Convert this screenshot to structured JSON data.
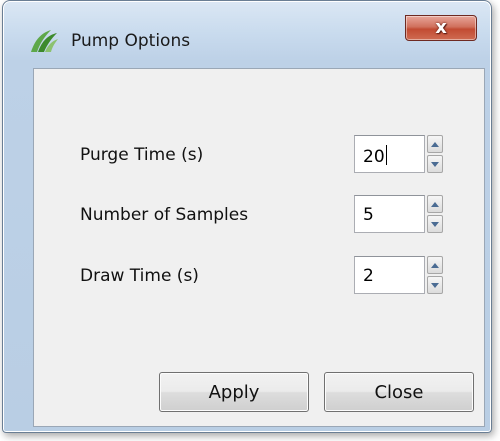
{
  "window": {
    "title": "Pump Options",
    "close_symbol": "x"
  },
  "icons": {
    "app": "leaf-logo-icon",
    "close": "close-icon",
    "spin_up": "arrow-up-icon",
    "spin_down": "arrow-down-icon"
  },
  "fields": [
    {
      "label": "Purge Time (s)",
      "value": "20"
    },
    {
      "label": "Number of Samples",
      "value": "5"
    },
    {
      "label": "Draw Time (s)",
      "value": "2"
    }
  ],
  "buttons": {
    "apply": "Apply",
    "close": "Close"
  },
  "colors": {
    "accent_green": "#3d8a2c",
    "close_button": "#c24b33"
  }
}
